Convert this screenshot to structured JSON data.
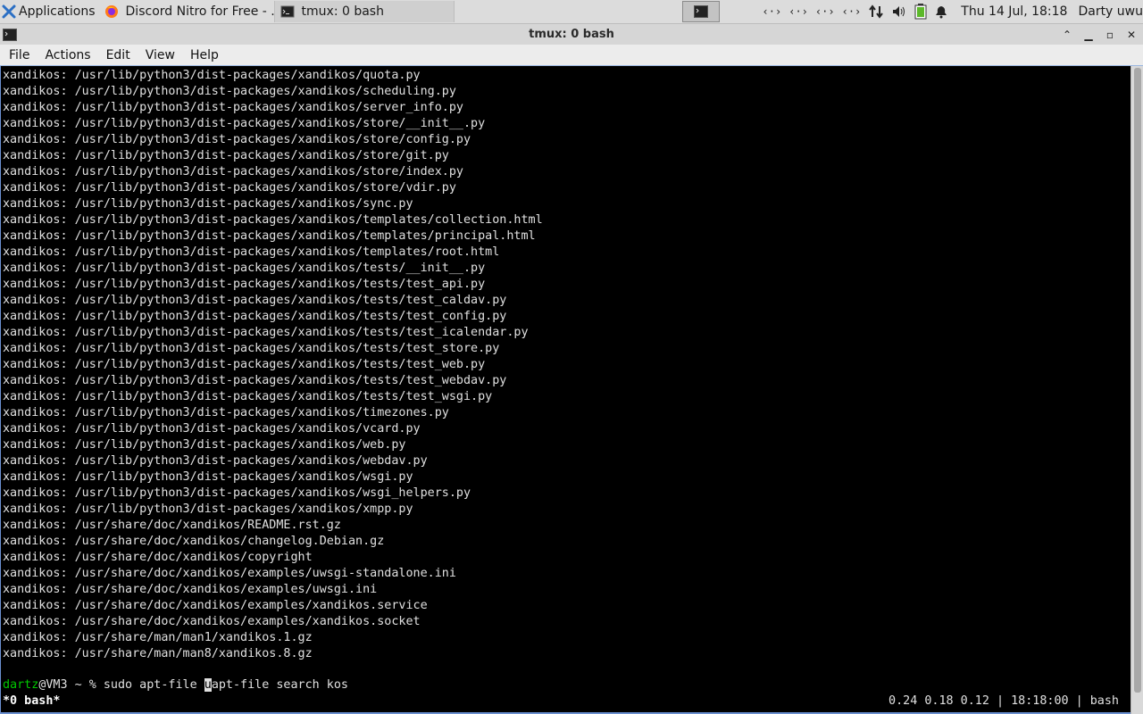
{
  "panel": {
    "apps_label": "Applications",
    "tasks": [
      {
        "label": "Discord Nitro for Free - ...",
        "icon": "firefox-icon"
      },
      {
        "label": "tmux: 0 bash",
        "icon": "terminal-icon"
      }
    ],
    "clock": "Thu 14 Jul, 18:18",
    "user": "Darty uwu",
    "tray_icons": [
      "network-icon",
      "network-icon",
      "network-icon",
      "network-icon",
      "transfer-icon",
      "volume-icon",
      "battery-icon",
      "bell-icon"
    ]
  },
  "window": {
    "title": "tmux: 0 bash",
    "menu": [
      "File",
      "Actions",
      "Edit",
      "View",
      "Help"
    ]
  },
  "terminal": {
    "lines": [
      "xandikos: /usr/lib/python3/dist-packages/xandikos/quota.py",
      "xandikos: /usr/lib/python3/dist-packages/xandikos/scheduling.py",
      "xandikos: /usr/lib/python3/dist-packages/xandikos/server_info.py",
      "xandikos: /usr/lib/python3/dist-packages/xandikos/store/__init__.py",
      "xandikos: /usr/lib/python3/dist-packages/xandikos/store/config.py",
      "xandikos: /usr/lib/python3/dist-packages/xandikos/store/git.py",
      "xandikos: /usr/lib/python3/dist-packages/xandikos/store/index.py",
      "xandikos: /usr/lib/python3/dist-packages/xandikos/store/vdir.py",
      "xandikos: /usr/lib/python3/dist-packages/xandikos/sync.py",
      "xandikos: /usr/lib/python3/dist-packages/xandikos/templates/collection.html",
      "xandikos: /usr/lib/python3/dist-packages/xandikos/templates/principal.html",
      "xandikos: /usr/lib/python3/dist-packages/xandikos/templates/root.html",
      "xandikos: /usr/lib/python3/dist-packages/xandikos/tests/__init__.py",
      "xandikos: /usr/lib/python3/dist-packages/xandikos/tests/test_api.py",
      "xandikos: /usr/lib/python3/dist-packages/xandikos/tests/test_caldav.py",
      "xandikos: /usr/lib/python3/dist-packages/xandikos/tests/test_config.py",
      "xandikos: /usr/lib/python3/dist-packages/xandikos/tests/test_icalendar.py",
      "xandikos: /usr/lib/python3/dist-packages/xandikos/tests/test_store.py",
      "xandikos: /usr/lib/python3/dist-packages/xandikos/tests/test_web.py",
      "xandikos: /usr/lib/python3/dist-packages/xandikos/tests/test_webdav.py",
      "xandikos: /usr/lib/python3/dist-packages/xandikos/tests/test_wsgi.py",
      "xandikos: /usr/lib/python3/dist-packages/xandikos/timezones.py",
      "xandikos: /usr/lib/python3/dist-packages/xandikos/vcard.py",
      "xandikos: /usr/lib/python3/dist-packages/xandikos/web.py",
      "xandikos: /usr/lib/python3/dist-packages/xandikos/webdav.py",
      "xandikos: /usr/lib/python3/dist-packages/xandikos/wsgi.py",
      "xandikos: /usr/lib/python3/dist-packages/xandikos/wsgi_helpers.py",
      "xandikos: /usr/lib/python3/dist-packages/xandikos/xmpp.py",
      "xandikos: /usr/share/doc/xandikos/README.rst.gz",
      "xandikos: /usr/share/doc/xandikos/changelog.Debian.gz",
      "xandikos: /usr/share/doc/xandikos/copyright",
      "xandikos: /usr/share/doc/xandikos/examples/uwsgi-standalone.ini",
      "xandikos: /usr/share/doc/xandikos/examples/uwsgi.ini",
      "xandikos: /usr/share/doc/xandikos/examples/xandikos.service",
      "xandikos: /usr/share/doc/xandikos/examples/xandikos.socket",
      "xandikos: /usr/share/man/man1/xandikos.1.gz",
      "xandikos: /usr/share/man/man8/xandikos.8.gz"
    ],
    "prompt_user": "dartz",
    "prompt_host": "@VM3 ~ % ",
    "command_before_cursor": "sudo apt-file u",
    "cursor_char": "u",
    "command_after_cursor": "apt-file search kos",
    "status_left": "*0 bash*",
    "status_right": "0.24 0.18 0.12 | 18:18:00 | bash"
  }
}
